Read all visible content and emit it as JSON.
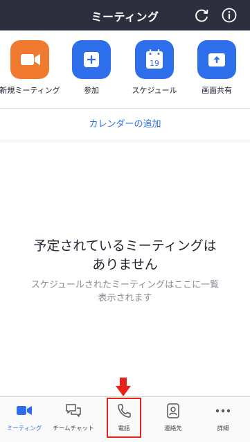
{
  "header": {
    "title": "ミーティング"
  },
  "actions": [
    {
      "label": "新規ミーティング",
      "icon": "video-camera-icon",
      "color": "#f07a2f"
    },
    {
      "label": "参加",
      "icon": "plus-icon",
      "color": "#2d6eea"
    },
    {
      "label": "スケジュール",
      "icon": "calendar-icon",
      "color": "#2d6eea",
      "calendar_day": "19"
    },
    {
      "label": "画面共有",
      "icon": "share-screen-icon",
      "color": "#2d6eea"
    }
  ],
  "add_calendar": "カレンダーの追加",
  "empty_state": {
    "title_line1": "予定されているミーティングは",
    "title_line2": "ありません",
    "subtitle_line1": "スケジュールされたミーティングはここに一覧",
    "subtitle_line2": "表示されます"
  },
  "tabs": [
    {
      "label": "ミーティング",
      "icon": "video-camera-icon",
      "active": true
    },
    {
      "label": "チームチャット",
      "icon": "chat-bubbles-icon",
      "active": false
    },
    {
      "label": "電話",
      "icon": "phone-icon",
      "active": false,
      "highlighted": true
    },
    {
      "label": "連絡先",
      "icon": "contact-card-icon",
      "active": false
    },
    {
      "label": "詳細",
      "icon": "more-dots-icon",
      "active": false
    }
  ],
  "colors": {
    "header_bg": "#2d2f3e",
    "accent": "#2d6eea",
    "highlight": "#e8221a"
  }
}
